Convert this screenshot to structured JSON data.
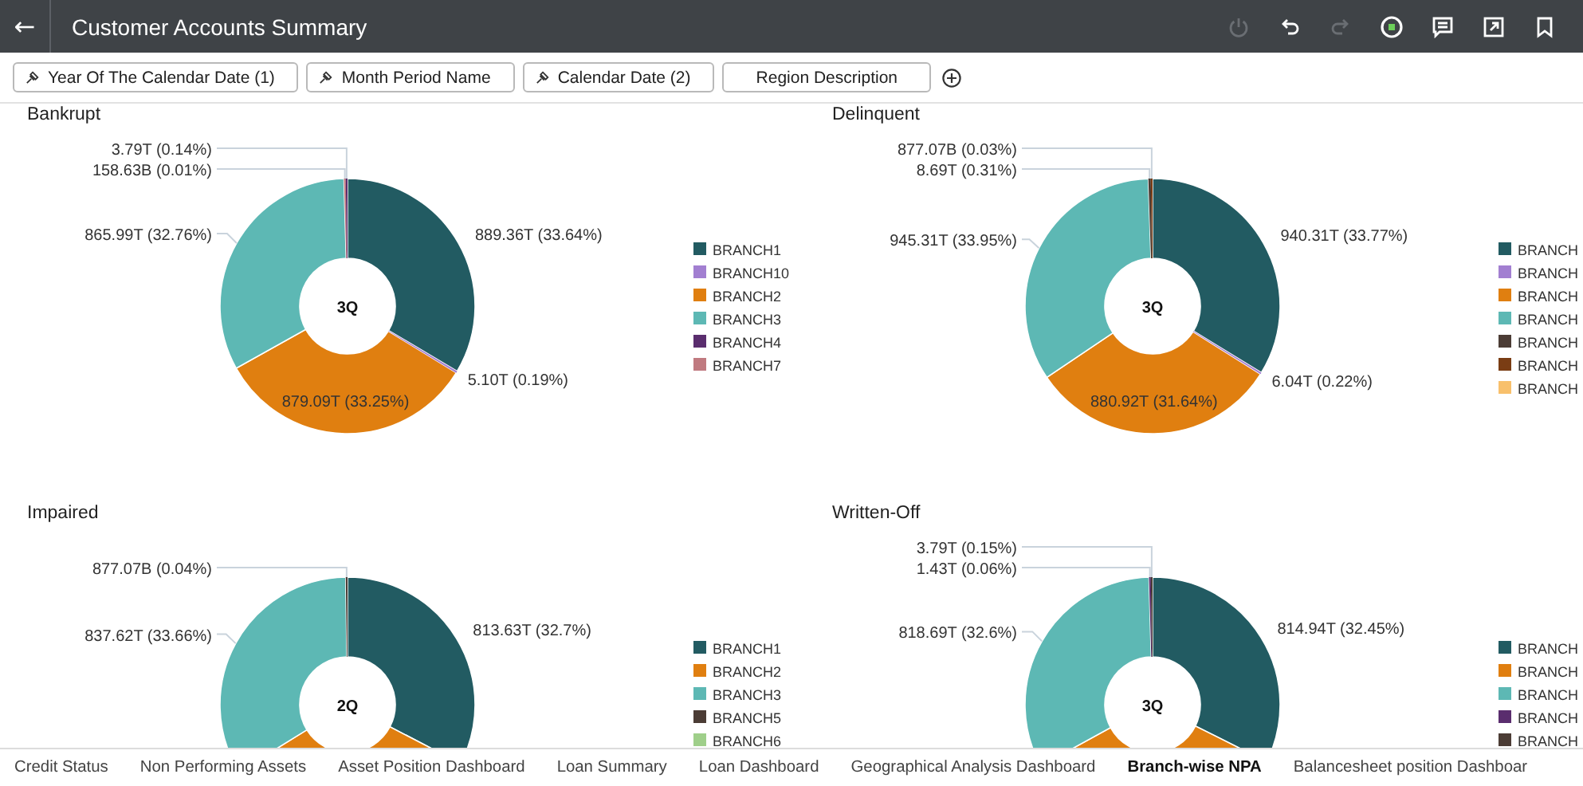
{
  "header": {
    "back": "←",
    "title": "Customer Accounts Summary",
    "toolbar": [
      {
        "kind": "power",
        "disabled": true
      },
      {
        "kind": "undo",
        "disabled": false
      },
      {
        "kind": "redo",
        "disabled": true
      },
      {
        "kind": "progress",
        "disabled": false
      },
      {
        "kind": "comment",
        "disabled": false
      },
      {
        "kind": "export",
        "disabled": false
      },
      {
        "kind": "bookmark",
        "disabled": false
      }
    ]
  },
  "filters": [
    {
      "label": "Year Of The Calendar Date (1)",
      "pinned": true
    },
    {
      "label": "Month Period Name",
      "pinned": true
    },
    {
      "label": "Calendar Date (2)",
      "pinned": true
    },
    {
      "label": "Region Description",
      "pinned": false
    }
  ],
  "charts": [
    {
      "title": "Bankrupt",
      "center_label": "3Q",
      "chart_data": {
        "type": "donut",
        "values": [
          33.64,
          0.19,
          33.25,
          32.76,
          0.01,
          0.14
        ],
        "colors": [
          "#225b62",
          "#a27fd1",
          "#e07f10",
          "#5db8b4",
          "#c07a80",
          "#5a2d6e"
        ],
        "value_labels": [
          "889.36T (33.64%)",
          "5.10T (0.19%)",
          "879.09T (33.25%)",
          "865.99T (32.76%)",
          "158.63B (0.01%)",
          "3.79T (0.14%)"
        ]
      },
      "legend": [
        {
          "label": "BRANCH1",
          "color": "#225b62"
        },
        {
          "label": "BRANCH10",
          "color": "#a27fd1"
        },
        {
          "label": "BRANCH2",
          "color": "#e07f10"
        },
        {
          "label": "BRANCH3",
          "color": "#5db8b4"
        },
        {
          "label": "BRANCH4",
          "color": "#5a2d6e"
        },
        {
          "label": "BRANCH7",
          "color": "#c07a80"
        }
      ]
    },
    {
      "title": "Delinquent",
      "center_label": "3Q",
      "chart_data": {
        "type": "donut",
        "values": [
          33.77,
          0.22,
          31.64,
          33.95,
          0.31,
          0.03
        ],
        "colors": [
          "#225b62",
          "#a27fd1",
          "#e07f10",
          "#5db8b4",
          "#4b3c35",
          "#7a3d14"
        ],
        "value_labels": [
          "940.31T (33.77%)",
          "6.04T (0.22%)",
          "880.92T (31.64%)",
          "945.31T (33.95%)",
          "8.69T (0.31%)",
          "877.07B (0.03%)"
        ]
      },
      "legend": [
        {
          "label": "BRANCH",
          "color": "#225b62"
        },
        {
          "label": "BRANCH",
          "color": "#a27fd1"
        },
        {
          "label": "BRANCH",
          "color": "#e07f10"
        },
        {
          "label": "BRANCH",
          "color": "#5db8b4"
        },
        {
          "label": "BRANCH",
          "color": "#4b3c35"
        },
        {
          "label": "BRANCH",
          "color": "#7a3d14"
        },
        {
          "label": "BRANCH",
          "color": "#f8c06c"
        }
      ]
    },
    {
      "title": "Impaired",
      "center_label": "2Q",
      "chart_data": {
        "type": "donut",
        "values": [
          32.7,
          33.6,
          33.66,
          0.04
        ],
        "colors": [
          "#225b62",
          "#e07f10",
          "#5db8b4",
          "#4b3c35"
        ],
        "value_labels": [
          "813.63T (32.7%)",
          null,
          "837.62T (33.66%)",
          "877.07B (0.04%)"
        ]
      },
      "legend": [
        {
          "label": "BRANCH1",
          "color": "#225b62"
        },
        {
          "label": "BRANCH2",
          "color": "#e07f10"
        },
        {
          "label": "BRANCH3",
          "color": "#5db8b4"
        },
        {
          "label": "BRANCH5",
          "color": "#4b3c35"
        },
        {
          "label": "BRANCH6",
          "color": "#9fcf8a"
        }
      ]
    },
    {
      "title": "Written-Off",
      "center_label": "3Q",
      "chart_data": {
        "type": "donut",
        "values": [
          32.45,
          34.74,
          32.6,
          0.06,
          0.15
        ],
        "colors": [
          "#225b62",
          "#e07f10",
          "#5db8b4",
          "#5a2d6e",
          "#4b3c35"
        ],
        "value_labels": [
          "814.94T (32.45%)",
          null,
          "818.69T (32.6%)",
          "1.43T (0.06%)",
          "3.79T (0.15%)"
        ]
      },
      "legend": [
        {
          "label": "BRANCH",
          "color": "#225b62"
        },
        {
          "label": "BRANCH",
          "color": "#e07f10"
        },
        {
          "label": "BRANCH",
          "color": "#5db8b4"
        },
        {
          "label": "BRANCH",
          "color": "#5a2d6e"
        },
        {
          "label": "BRANCH",
          "color": "#4b3c35"
        }
      ]
    }
  ],
  "bottom_tabs": [
    {
      "label": "Credit Status",
      "selected": false
    },
    {
      "label": "Non Performing Assets",
      "selected": false
    },
    {
      "label": "Asset Position Dashboard",
      "selected": false
    },
    {
      "label": "Loan Summary",
      "selected": false
    },
    {
      "label": "Loan Dashboard",
      "selected": false
    },
    {
      "label": "Geographical Analysis Dashboard",
      "selected": false
    },
    {
      "label": "Branch-wise NPA",
      "selected": true
    },
    {
      "label": "Balancesheet position Dashboar",
      "selected": false
    }
  ]
}
